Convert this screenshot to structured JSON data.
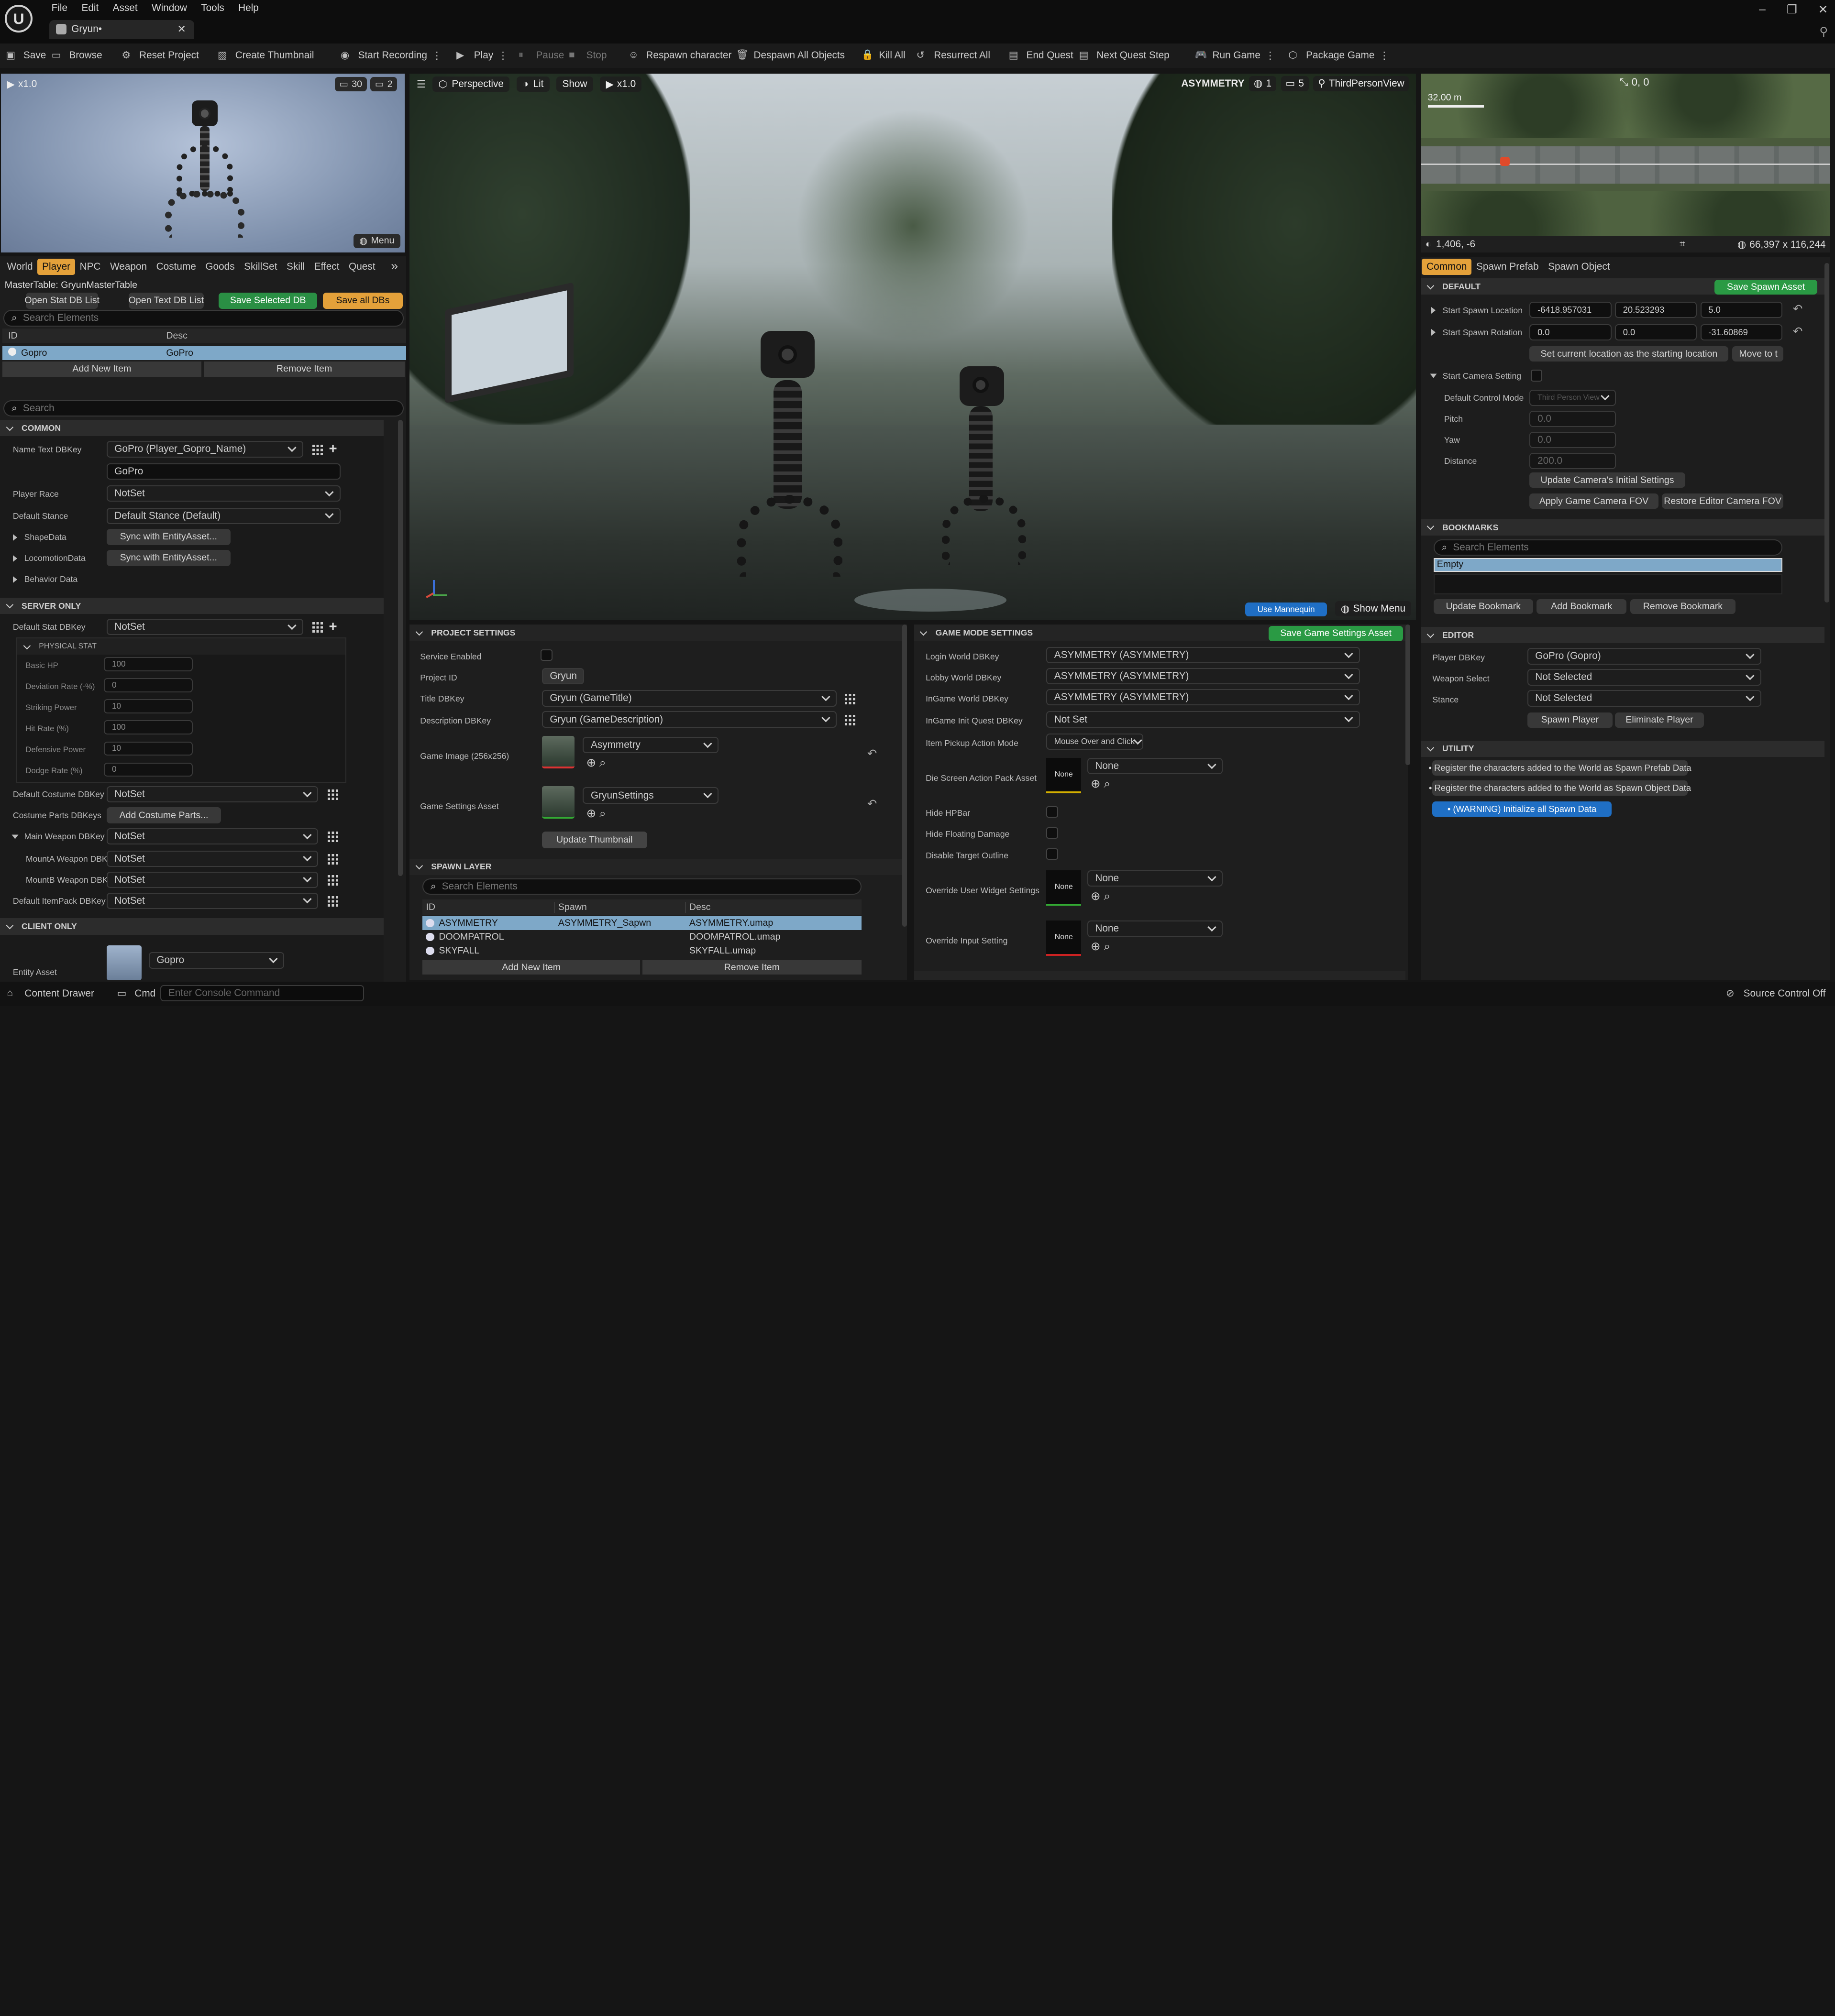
{
  "menubar": {
    "items": [
      "File",
      "Edit",
      "Asset",
      "Window",
      "Tools",
      "Help"
    ]
  },
  "tab": {
    "title": "Gryun•"
  },
  "toolbar": {
    "save": "Save",
    "browse": "Browse",
    "reset": "Reset Project",
    "thumb": "Create Thumbnail",
    "record": "Start Recording",
    "play": "Play",
    "pause": "Pause",
    "stop": "Stop",
    "respawn": "Respawn character",
    "despawn": "Despawn All Objects",
    "killall": "Kill All",
    "resurrect": "Resurrect All",
    "endquest": "End Quest",
    "nextquest": "Next Quest Step",
    "rungame": "Run Game",
    "package": "Package Game"
  },
  "preview": {
    "speed": "x1.0",
    "count1": "30",
    "count2": "2",
    "menu": "Menu"
  },
  "left": {
    "tabs": [
      "World",
      "Player",
      "NPC",
      "Weapon",
      "Costume",
      "Goods",
      "SkillSet",
      "Skill",
      "Effect",
      "Quest"
    ],
    "master_table": "MasterTable: GryunMasterTable",
    "buttons": {
      "open_stat": "Open Stat DB List",
      "open_text": "Open Text DB List",
      "save_sel": "Save Selected DB",
      "save_all": "Save all DBs"
    },
    "search_placeholder": "Search Elements",
    "col_id": "ID",
    "col_desc": "Desc",
    "row": {
      "id": "Gopro",
      "desc": "GoPro"
    },
    "add": "Add New Item",
    "remove": "Remove Item",
    "search2": "Search",
    "common": "COMMON",
    "name_key_label": "Name Text DBKey",
    "name_key": "GoPro (Player_Gopro_Name)",
    "name_text": "GoPro",
    "race_label": "Player Race",
    "race": "NotSet",
    "stance_label": "Default Stance",
    "stance": "Default Stance (Default)",
    "shape_label": "ShapeData",
    "loco_label": "LocomotionData",
    "behavior_label": "Behavior Data",
    "sync": "Sync with EntityAsset...",
    "server_only": "SERVER ONLY",
    "stat_label": "Default Stat DBKey",
    "stat": "NotSet",
    "physical": "PHYSICAL STAT",
    "stats": [
      {
        "label": "Basic HP",
        "value": "100"
      },
      {
        "label": "Deviation Rate (-%)",
        "value": "0"
      },
      {
        "label": "Striking Power",
        "value": "10"
      },
      {
        "label": "Hit Rate (%)",
        "value": "100"
      },
      {
        "label": "Defensive Power",
        "value": "10"
      },
      {
        "label": "Dodge Rate (%)",
        "value": "0"
      }
    ],
    "costume_label": "Default Costume DBKey",
    "costume": "NotSet",
    "parts_label": "Costume Parts DBKeys",
    "parts_btn": "Add Costume Parts...",
    "mainweapon_label": "Main Weapon DBKey",
    "mainweapon": "NotSet",
    "mounta_label": "MountA Weapon DBK",
    "mounta": "NotSet",
    "mountb_label": "MountB Weapon DBK",
    "mountb": "NotSet",
    "itempack_label": "Default ItemPack DBKey",
    "itempack": "NotSet",
    "client_only": "CLIENT ONLY",
    "entity_label": "Entity Asset",
    "entity": "Gopro"
  },
  "viewport": {
    "perspective": "Perspective",
    "lit": "Lit",
    "show": "Show",
    "speed": "x1.0",
    "level": "ASYMMETRY",
    "n1": "1",
    "n2": "5",
    "view": "ThirdPersonView",
    "mannequin": "Use Mannequin",
    "showmenu": "Show Menu"
  },
  "project": {
    "title": "PROJECT SETTINGS",
    "service_label": "Service Enabled",
    "pid_label": "Project ID",
    "pid": "Gryun",
    "title_label": "Title DBKey",
    "title_val": "Gryun (GameTitle)",
    "desc_label": "Description DBKey",
    "desc_val": "Gryun (GameDescription)",
    "image_label": "Game Image (256x256)",
    "image_val": "Asymmetry",
    "settings_label": "Game Settings Asset",
    "settings_val": "GryunSettings",
    "update": "Update Thumbnail"
  },
  "spawn": {
    "title": "SPAWN LAYER",
    "search": "Search Elements",
    "cols": [
      "ID",
      "Spawn",
      "Desc"
    ],
    "rows": [
      {
        "id": "ASYMMETRY",
        "spawn": "ASYMMETRY_Sapwn",
        "desc": "ASYMMETRY.umap"
      },
      {
        "id": "DOOMPATROL",
        "spawn": "",
        "desc": "DOOMPATROL.umap"
      },
      {
        "id": "SKYFALL",
        "spawn": "",
        "desc": "SKYFALL.umap"
      }
    ],
    "add": "Add New Item",
    "remove": "Remove Item"
  },
  "gamemode": {
    "title": "GAME MODE SETTINGS",
    "save": "Save Game Settings Asset",
    "login_label": "Login World DBKey",
    "login": "ASYMMETRY (ASYMMETRY)",
    "lobby_label": "Lobby World DBKey",
    "lobby": "ASYMMETRY (ASYMMETRY)",
    "ingame_label": "InGame World DBKey",
    "ingame": "ASYMMETRY (ASYMMETRY)",
    "quest_label": "InGame Init Quest DBKey",
    "quest": "Not Set",
    "pickup_label": "Item Pickup Action Mode",
    "pickup": "Mouse Over and Click",
    "die_label": "Die Screen Action Pack Asset",
    "hphbar_label": "Hide HPBar",
    "floating_label": "Hide Floating Damage",
    "outline_label": "Disable Target Outline",
    "widget_label": "Override User Widget Settings",
    "input_label": "Override Input Setting",
    "none": "None",
    "none_thumb": "None"
  },
  "minimap": {
    "scale": "32.00 m",
    "coords": "0, 0",
    "pos": "1,406, -6",
    "size": "66,397 x 116,244"
  },
  "right": {
    "tabs": [
      "Common",
      "Spawn Prefab",
      "Spawn Object"
    ],
    "default": "DEFAULT",
    "save_spawn": "Save Spawn Asset",
    "loc_label": "Start Spawn Location",
    "loc": [
      "-6418.957031",
      "20.523293",
      "5.0"
    ],
    "rot_label": "Start Spawn Rotation",
    "rot": [
      "0.0",
      "0.0",
      "-31.60869"
    ],
    "set_loc": "Set current location as the starting location",
    "move_to": "Move to t",
    "camera_label": "Start Camera Setting",
    "control_label": "Default Control Mode",
    "control": "Third Person View",
    "pitch_label": "Pitch",
    "pitch": "0.0",
    "yaw_label": "Yaw",
    "yaw": "0.0",
    "dist_label": "Distance",
    "dist": "200.0",
    "update_cam": "Update Camera's Initial Settings",
    "apply_fov": "Apply Game Camera FOV",
    "restore_fov": "Restore Editor Camera FOV",
    "bookmarks": "BOOKMARKS",
    "bm_search": "Search Elements",
    "bm_empty": "Empty",
    "bm_update": "Update Bookmark",
    "bm_add": "Add Bookmark",
    "bm_remove": "Remove Bookmark",
    "editor": "EDITOR",
    "player_label": "Player DBKey",
    "player": "GoPro (Gopro)",
    "weapon_label": "Weapon Select",
    "weapon": "Not Selected",
    "stance_label": "Stance",
    "stance": "Not Selected",
    "spawn_player": "Spawn Player",
    "eliminate": "Eliminate Player",
    "utility": "UTILITY",
    "util1": "• Register the characters added to the World as Spawn Prefab Data",
    "util2": "• Register the characters added to the World as Spawn Object Data",
    "util3": "• (WARNING) Initialize all Spawn Data"
  },
  "statusbar": {
    "drawer": "Content Drawer",
    "cmd": "Cmd",
    "console": "Enter Console Command",
    "source": "Source Control Off"
  },
  "colors": {
    "accent_orange": "#e4a13a",
    "accent_green": "#1c8a3a",
    "accent_blue": "#1f6fc5",
    "selection": "#7ea8c8"
  }
}
